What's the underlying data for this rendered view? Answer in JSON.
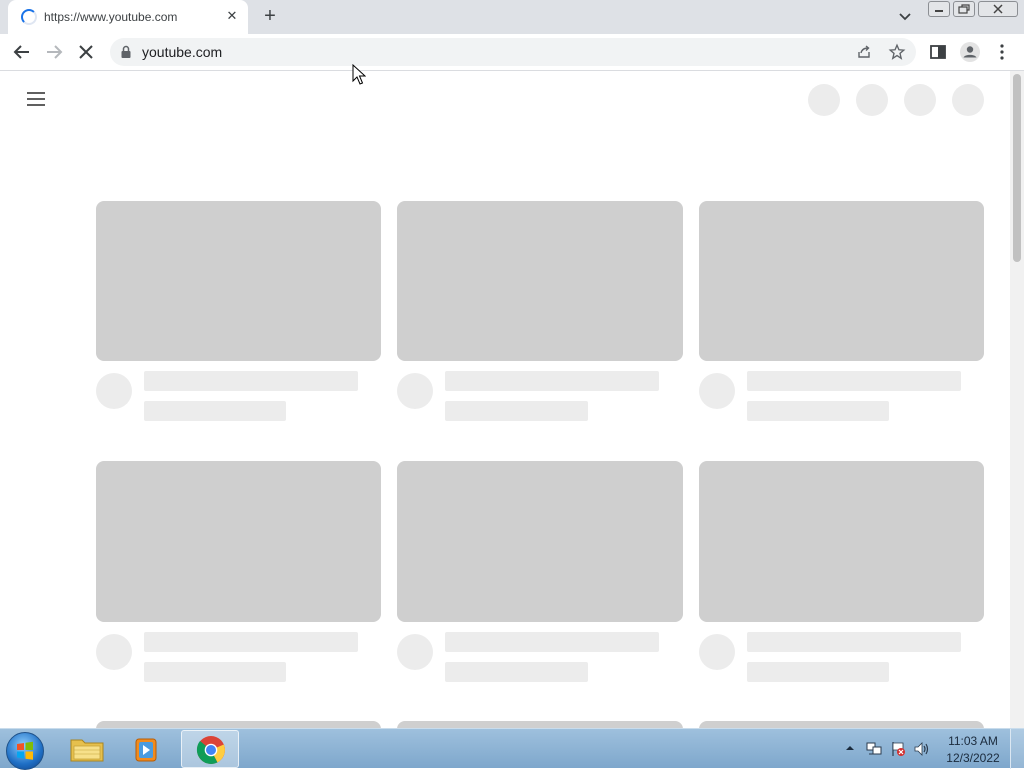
{
  "browser": {
    "tab": {
      "title": "https://www.youtube.com",
      "close_symbol": "✕",
      "loading": true
    },
    "new_tab_symbol": "+",
    "omnibox": {
      "url": "youtube.com"
    },
    "icons": {
      "back": "back-arrow-icon",
      "forward": "forward-arrow-icon",
      "stop": "stop-loading-icon",
      "lock": "lock-icon",
      "share": "share-icon",
      "bookmark": "star-icon",
      "side_panel": "side-panel-icon",
      "profile": "profile-icon",
      "menu": "kebab-menu-icon"
    }
  },
  "page": {
    "status": "loading skeleton",
    "grid": {
      "columns": 3,
      "rows_visible": 2
    }
  },
  "taskbar": {
    "items": [
      "windows-explorer",
      "media-player",
      "google-chrome"
    ],
    "active_item": "google-chrome",
    "clock": {
      "time": "11:03 AM",
      "date": "12/3/2022"
    }
  },
  "colors": {
    "tab_strip": "#dee1e6",
    "skeleton_thumb": "#cfcfcf",
    "skeleton_line": "#ececec",
    "taskbar": "#8fb3d5"
  }
}
